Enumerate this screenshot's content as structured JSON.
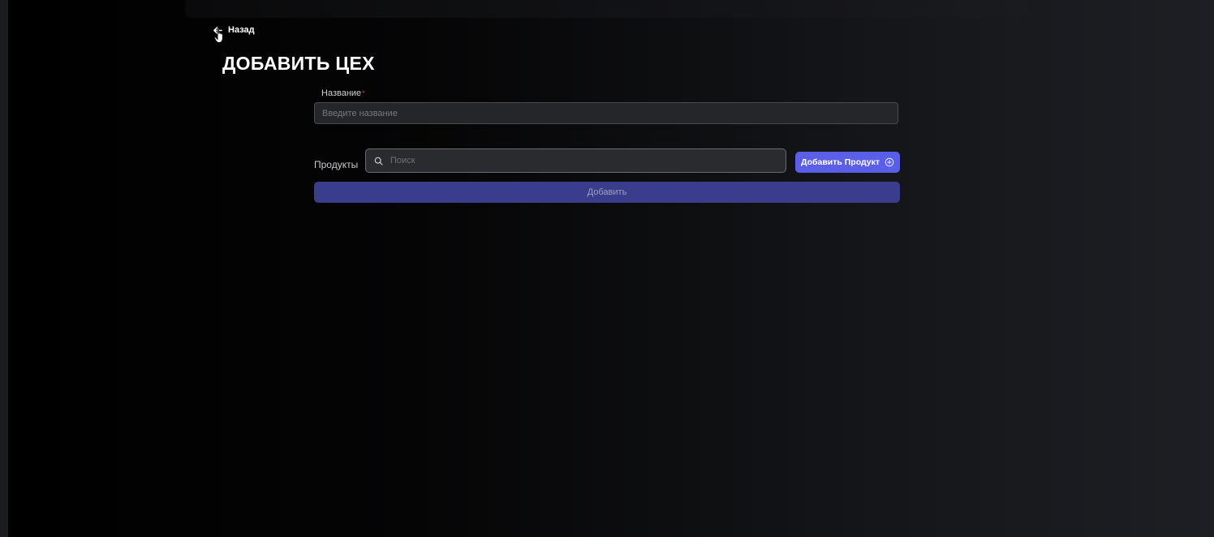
{
  "header": {
    "back_label": "Назад",
    "back_icon": "arrow-left-icon"
  },
  "page": {
    "title": "ДОБАВИТЬ ЦЕХ"
  },
  "form": {
    "name_label": "Название",
    "name_required_mark": "*",
    "name_placeholder": "Введите название",
    "name_value": "",
    "products_label": "Продукты",
    "search_placeholder": "Поиск",
    "search_value": "",
    "search_icon": "search-icon",
    "add_product_label": "Добавить Продукт",
    "add_product_icon": "plus-circle-icon",
    "submit_label": "Добавить"
  },
  "colors": {
    "accent": "#5b5fe8",
    "submit_bg": "#3a3d8c",
    "required": "#e04848"
  }
}
